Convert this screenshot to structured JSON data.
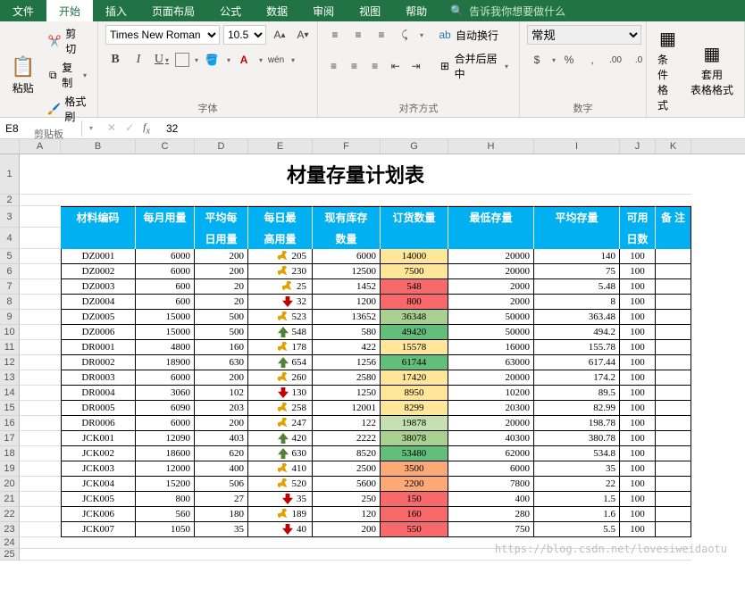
{
  "tabs": [
    "文件",
    "开始",
    "插入",
    "页面布局",
    "公式",
    "数据",
    "审阅",
    "视图",
    "帮助"
  ],
  "tell_me": "告诉我你想要做什么",
  "clipboard": {
    "paste": "粘贴",
    "cut": "剪切",
    "copy": "复制",
    "format": "格式刷",
    "label": "剪贴板"
  },
  "font": {
    "name": "Times New Roman",
    "size": "10.5",
    "label": "字体"
  },
  "align": {
    "wrap": "自动换行",
    "merge": "合并后居中",
    "label": "对齐方式"
  },
  "number": {
    "format": "常规",
    "label": "数字"
  },
  "styles": {
    "cond": "条件格式",
    "table": "套用\n表格格式"
  },
  "namebox": "E8",
  "fx_value": "32",
  "col_letters": [
    "A",
    "B",
    "C",
    "D",
    "E",
    "F",
    "G",
    "H",
    "I",
    "J",
    "K"
  ],
  "title": "材量存量计划表",
  "headers": {
    "b": "材料编码",
    "c": "每月用量",
    "d1": "平均每",
    "d2": "日用量",
    "e1": "每日最",
    "e2": "高用量",
    "f1": "现有库存",
    "f2": "数量",
    "g": "订货数量",
    "h": "最低存量",
    "i": "平均存量",
    "j1": "可用",
    "j2": "日数",
    "k": "备    注"
  },
  "rows": [
    {
      "id": "DZ0001",
      "month": 6000,
      "avg": 200,
      "arr": "side",
      "max": 205,
      "stock": 6000,
      "order": 14000,
      "oc": "#ffe699",
      "min": 20000,
      "mean": 140,
      "days": 100
    },
    {
      "id": "DZ0002",
      "month": 6000,
      "avg": 200,
      "arr": "side",
      "max": 230,
      "stock": 12500,
      "order": 7500,
      "oc": "#ffe699",
      "min": 20000,
      "mean": 75,
      "days": 100
    },
    {
      "id": "DZ0003",
      "month": 600,
      "avg": 20,
      "arr": "side",
      "max": 25,
      "stock": 1452,
      "order": 548,
      "oc": "#f8696b",
      "min": 2000,
      "mean": 5.48,
      "days": 100
    },
    {
      "id": "DZ0004",
      "month": 600,
      "avg": 20,
      "arr": "down",
      "max": 32,
      "stock": 1200,
      "order": 800,
      "oc": "#f8696b",
      "min": 2000,
      "mean": 8,
      "days": 100
    },
    {
      "id": "DZ0005",
      "month": 15000,
      "avg": 500,
      "arr": "side",
      "max": 523,
      "stock": 13652,
      "order": 36348,
      "oc": "#a9d08e",
      "min": 50000,
      "mean": 363.48,
      "days": 100
    },
    {
      "id": "DZ0006",
      "month": 15000,
      "avg": 500,
      "arr": "up",
      "max": 548,
      "stock": 580,
      "order": 49420,
      "oc": "#63be7b",
      "min": 50000,
      "mean": 494.2,
      "days": 100
    },
    {
      "id": "DR0001",
      "month": 4800,
      "avg": 160,
      "arr": "side",
      "max": 178,
      "stock": 422,
      "order": 15578,
      "oc": "#ffe699",
      "min": 16000,
      "mean": 155.78,
      "days": 100
    },
    {
      "id": "DR0002",
      "month": 18900,
      "avg": 630,
      "arr": "up",
      "max": 654,
      "stock": 1256,
      "order": 61744,
      "oc": "#63be7b",
      "min": 63000,
      "mean": 617.44,
      "days": 100
    },
    {
      "id": "DR0003",
      "month": 6000,
      "avg": 200,
      "arr": "side",
      "max": 260,
      "stock": 2580,
      "order": 17420,
      "oc": "#ffe699",
      "min": 20000,
      "mean": 174.2,
      "days": 100
    },
    {
      "id": "DR0004",
      "month": 3060,
      "avg": 102,
      "arr": "down",
      "max": 130,
      "stock": 1250,
      "order": 8950,
      "oc": "#ffe699",
      "min": 10200,
      "mean": 89.5,
      "days": 100
    },
    {
      "id": "DR0005",
      "month": 6090,
      "avg": 203,
      "arr": "side",
      "max": 258,
      "stock": 12001,
      "order": 8299,
      "oc": "#ffe699",
      "min": 20300,
      "mean": 82.99,
      "days": 100
    },
    {
      "id": "DR0006",
      "month": 6000,
      "avg": 200,
      "arr": "side",
      "max": 247,
      "stock": 122,
      "order": 19878,
      "oc": "#c6e0b4",
      "min": 20000,
      "mean": 198.78,
      "days": 100
    },
    {
      "id": "JCK001",
      "month": 12090,
      "avg": 403,
      "arr": "up",
      "max": 420,
      "stock": 2222,
      "order": 38078,
      "oc": "#a9d08e",
      "min": 40300,
      "mean": 380.78,
      "days": 100
    },
    {
      "id": "JCK002",
      "month": 18600,
      "avg": 620,
      "arr": "up",
      "max": 630,
      "stock": 8520,
      "order": 53480,
      "oc": "#63be7b",
      "min": 62000,
      "mean": 534.8,
      "days": 100
    },
    {
      "id": "JCK003",
      "month": 12000,
      "avg": 400,
      "arr": "side",
      "max": 410,
      "stock": 2500,
      "order": 3500,
      "oc": "#fba977",
      "min": 6000,
      "mean": 35,
      "days": 100
    },
    {
      "id": "JCK004",
      "month": 15200,
      "avg": 506,
      "arr": "side",
      "max": 520,
      "stock": 5600,
      "order": 2200,
      "oc": "#fba977",
      "min": 7800,
      "mean": 22,
      "days": 100
    },
    {
      "id": "JCK005",
      "month": 800,
      "avg": 27,
      "arr": "down",
      "max": 35,
      "stock": 250,
      "order": 150,
      "oc": "#f8696b",
      "min": 400,
      "mean": 1.5,
      "days": 100
    },
    {
      "id": "JCK006",
      "month": 560,
      "avg": 180,
      "arr": "side",
      "max": 189,
      "stock": 120,
      "order": 160,
      "oc": "#f8696b",
      "min": 280,
      "mean": 1.6,
      "days": 100
    },
    {
      "id": "JCK007",
      "month": 1050,
      "avg": 35,
      "arr": "down",
      "max": 40,
      "stock": 200,
      "order": 550,
      "oc": "#f8696b",
      "min": 750,
      "mean": 5.5,
      "days": 100
    }
  ],
  "watermark": "https://blog.csdn.net/lovesiweidaotu"
}
